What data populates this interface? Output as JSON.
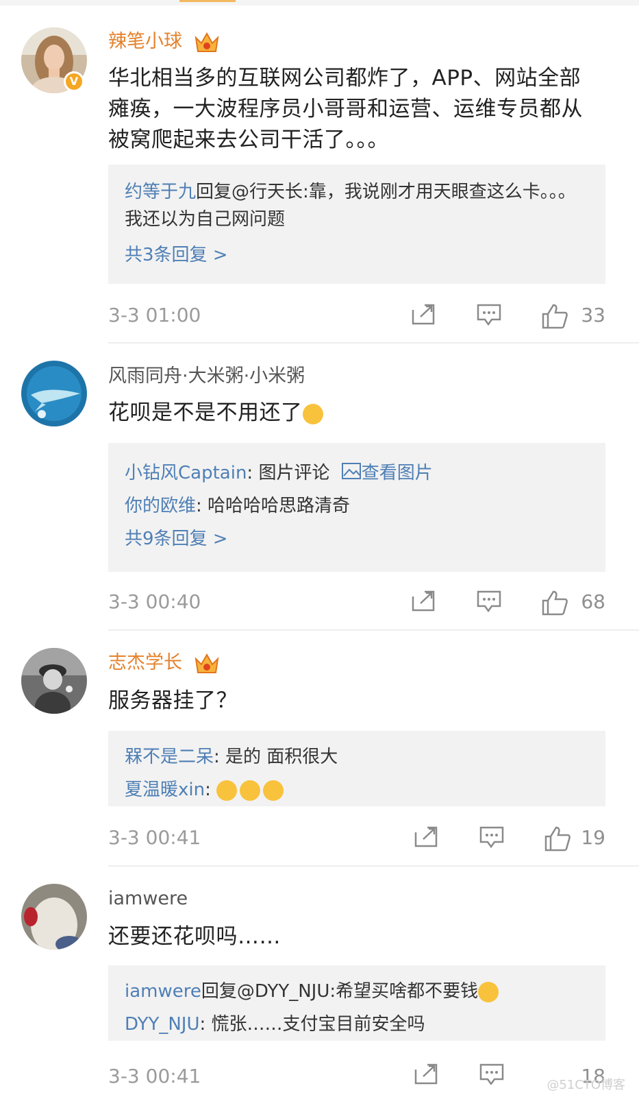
{
  "comments": [
    {
      "username": "辣笔小球",
      "text": "华北相当多的互联网公司都炸了，APP、网站全部瘫痪，一大波程序员小哥哥和运营、运维专员都从被窝爬起来去公司干活了。。。",
      "replies": [
        {
          "name": "约等于九",
          "text": "回复@行天长:靠，我说刚才用天眼查这么卡。。。我还以为自己网问题"
        }
      ],
      "more": "共3条回复 >",
      "time": "3-3 01:00",
      "likes": "33"
    },
    {
      "username": "风雨同舟·大米粥·小米粥",
      "text": "花呗是不是不用还了",
      "replies": [
        {
          "name": "小钻风Captain",
          "text": ": 图片评论",
          "link": "查看图片"
        },
        {
          "name": "你的欧维",
          "text": ": 哈哈哈哈思路清奇"
        }
      ],
      "more": "共9条回复 >",
      "time": "3-3 00:40",
      "likes": "68"
    },
    {
      "username": "志杰学长",
      "text": "服务器挂了？",
      "replies": [
        {
          "name": "槑不是二呆",
          "text": ": 是的 面积很大"
        },
        {
          "name": "夏温暖xin",
          "text": ": "
        }
      ],
      "time": "3-3 00:41",
      "likes": "19"
    },
    {
      "username": "iamwere",
      "text": "还要还花呗吗……",
      "replies": [
        {
          "name": "iamwere",
          "text": "回复@DYY_NJU:希望买啥都不要钱"
        },
        {
          "name": "DYY_NJU",
          "text": ": 慌张……支付宝目前安全吗"
        }
      ],
      "time": "3-3 00:41",
      "likes": "18"
    }
  ],
  "badge": "V",
  "watermark": "@51CTO博客",
  "colors": {
    "vip_name": "#e5812c",
    "reply_name": "#4e7fb5",
    "reply_bg": "#f2f2f2",
    "meta_gray": "#9a9a9a"
  }
}
